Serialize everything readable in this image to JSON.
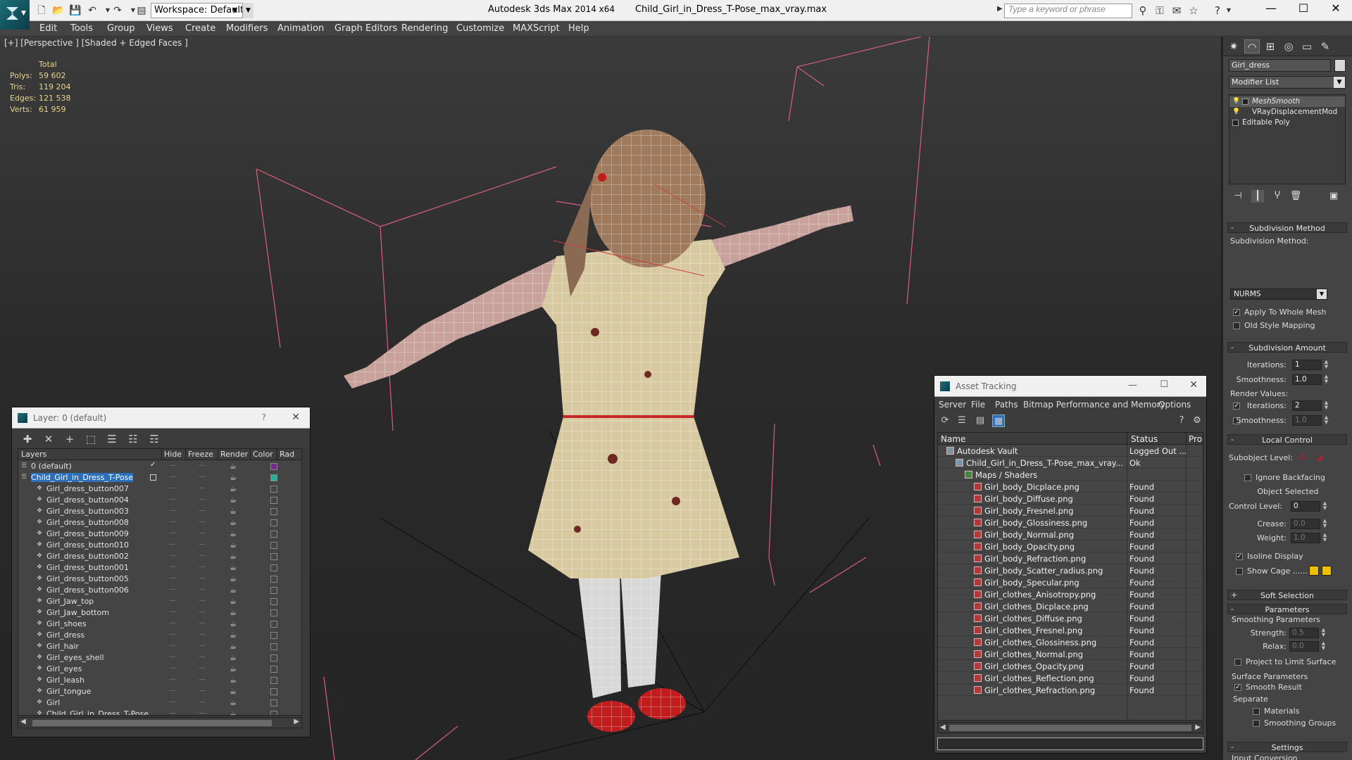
{
  "titlebar": {
    "workspace": "Workspace: Default",
    "app_name": "Autodesk 3ds Max",
    "app_version": "2014 x64",
    "file_name": "Child_Girl_in_Dress_T-Pose_max_vray.max",
    "search_placeholder": "Type a keyword or phrase"
  },
  "menu": [
    "Edit",
    "Tools",
    "Group",
    "Views",
    "Create",
    "Modifiers",
    "Animation",
    "Graph Editors",
    "Rendering",
    "Customize",
    "MAXScript",
    "Help"
  ],
  "viewport": {
    "label": "[+] [Perspective ] [Shaded + Edged Faces ]",
    "stats": {
      "header": "Total",
      "rows": [
        {
          "k": "Polys:",
          "v": "59 602"
        },
        {
          "k": "Tris:",
          "v": "119 204"
        },
        {
          "k": "Edges:",
          "v": "121 538"
        },
        {
          "k": "Verts:",
          "v": "61 959"
        }
      ]
    }
  },
  "layer_panel": {
    "title": "Layer: 0 (default)",
    "help": "?",
    "close": "✕",
    "headers": [
      "Layers",
      "Hide",
      "Freeze",
      "Render",
      "Color",
      "Rad"
    ],
    "rows": [
      {
        "name": "0 (default)",
        "level": 0,
        "swatch": "#7a2a8a",
        "check": true
      },
      {
        "name": "Child_Girl_in_Dress_T-Pose",
        "level": 0,
        "swatch": "#2ab09a",
        "selected": true
      },
      {
        "name": "Girl_dress_button007",
        "level": 1
      },
      {
        "name": "Girl_dress_button004",
        "level": 1
      },
      {
        "name": "Girl_dress_button003",
        "level": 1
      },
      {
        "name": "Girl_dress_button008",
        "level": 1
      },
      {
        "name": "Girl_dress_button009",
        "level": 1
      },
      {
        "name": "Girl_dress_button010",
        "level": 1
      },
      {
        "name": "Girl_dress_button002",
        "level": 1
      },
      {
        "name": "Girl_dress_button001",
        "level": 1
      },
      {
        "name": "Girl_dress_button005",
        "level": 1
      },
      {
        "name": "Girl_dress_button006",
        "level": 1
      },
      {
        "name": "Girl_Jaw_top",
        "level": 1
      },
      {
        "name": "Girl_Jaw_bottom",
        "level": 1
      },
      {
        "name": "Girl_shoes",
        "level": 1
      },
      {
        "name": "Girl_dress",
        "level": 1
      },
      {
        "name": "Girl_hair",
        "level": 1
      },
      {
        "name": "Girl_eyes_shell",
        "level": 1
      },
      {
        "name": "Girl_eyes",
        "level": 1
      },
      {
        "name": "Girl_leash",
        "level": 1
      },
      {
        "name": "Girl_tongue",
        "level": 1
      },
      {
        "name": "Girl",
        "level": 1
      },
      {
        "name": "Child_Girl_in_Dress_T-Pose",
        "level": 1
      }
    ]
  },
  "asset_panel": {
    "title": "Asset Tracking",
    "menu": [
      "Server",
      "File",
      "Paths",
      "Bitmap Performance and Memory",
      "Options"
    ],
    "headers": [
      "Name",
      "Status",
      "Pro"
    ],
    "rows": [
      {
        "name": "Autodesk Vault",
        "status": "Logged Out ...",
        "level": 0,
        "kind": "vault"
      },
      {
        "name": "Child_Girl_in_Dress_T-Pose_max_vray....",
        "status": "Ok",
        "level": 1,
        "kind": "file"
      },
      {
        "name": "Maps / Shaders",
        "status": "",
        "level": 2,
        "kind": "folder"
      },
      {
        "name": "Girl_body_Dicplace.png",
        "status": "Found",
        "level": 3,
        "kind": "png"
      },
      {
        "name": "Girl_body_Diffuse.png",
        "status": "Found",
        "level": 3,
        "kind": "png"
      },
      {
        "name": "Girl_body_Fresnel.png",
        "status": "Found",
        "level": 3,
        "kind": "png"
      },
      {
        "name": "Girl_body_Glossiness.png",
        "status": "Found",
        "level": 3,
        "kind": "png"
      },
      {
        "name": "Girl_body_Normal.png",
        "status": "Found",
        "level": 3,
        "kind": "png"
      },
      {
        "name": "Girl_body_Opacity.png",
        "status": "Found",
        "level": 3,
        "kind": "png"
      },
      {
        "name": "Girl_body_Refraction.png",
        "status": "Found",
        "level": 3,
        "kind": "png"
      },
      {
        "name": "Girl_body_Scatter_radius.png",
        "status": "Found",
        "level": 3,
        "kind": "png"
      },
      {
        "name": "Girl_body_Specular.png",
        "status": "Found",
        "level": 3,
        "kind": "png"
      },
      {
        "name": "Girl_clothes_Anisotropy.png",
        "status": "Found",
        "level": 3,
        "kind": "png"
      },
      {
        "name": "Girl_clothes_Dicplace.png",
        "status": "Found",
        "level": 3,
        "kind": "png"
      },
      {
        "name": "Girl_clothes_Diffuse.png",
        "status": "Found",
        "level": 3,
        "kind": "png"
      },
      {
        "name": "Girl_clothes_Fresnel.png",
        "status": "Found",
        "level": 3,
        "kind": "png"
      },
      {
        "name": "Girl_clothes_Glossiness.png",
        "status": "Found",
        "level": 3,
        "kind": "png"
      },
      {
        "name": "Girl_clothes_Normal.png",
        "status": "Found",
        "level": 3,
        "kind": "png"
      },
      {
        "name": "Girl_clothes_Opacity.png",
        "status": "Found",
        "level": 3,
        "kind": "png"
      },
      {
        "name": "Girl_clothes_Reflection.png",
        "status": "Found",
        "level": 3,
        "kind": "png"
      },
      {
        "name": "Girl_clothes_Refraction.png",
        "status": "Found",
        "level": 3,
        "kind": "png"
      }
    ]
  },
  "command_panel": {
    "object_name": "Girl_dress",
    "modifier_list": "Modifier List",
    "stack": [
      {
        "name": "MeshSmooth",
        "selected": true
      },
      {
        "name": "VRayDisplacementMod",
        "selected": false
      },
      {
        "name": "Editable Poly",
        "selected": false
      }
    ],
    "subdivision_method": {
      "title": "Subdivision Method",
      "label": "Subdivision Method:",
      "value": "NURMS",
      "apply_whole": "Apply To Whole Mesh",
      "apply_whole_checked": true,
      "old_style": "Old Style Mapping",
      "old_style_checked": false
    },
    "subdivision_amount": {
      "title": "Subdivision Amount",
      "iterations_label": "Iterations:",
      "iterations": "1",
      "smoothness_label": "Smoothness:",
      "smoothness": "1.0",
      "render_values": "Render Values:",
      "r_iterations_label": "Iterations:",
      "r_iterations": "2",
      "r_smoothness_label": "Smoothness:",
      "r_smoothness": "1.0"
    },
    "local_control": {
      "title": "Local Control",
      "subobject": "Subobject Level:",
      "ignore_backfacing": "Ignore Backfacing",
      "object_selected": "Object Selected",
      "control_level_label": "Control Level:",
      "control_level": "0",
      "crease_label": "Crease:",
      "crease": "0.0",
      "weight_label": "Weight:",
      "weight": "1.0",
      "isoline": "Isoline Display",
      "show_cage": "Show Cage ......",
      "cage_color1": "#f0c000",
      "cage_color2": "#f0c000"
    },
    "soft_selection": {
      "title": "Soft Selection"
    },
    "parameters": {
      "title": "Parameters",
      "smoothing": "Smoothing Parameters",
      "strength_label": "Strength:",
      "strength": "0.5",
      "relax_label": "Relax:",
      "relax": "0.0",
      "project": "Project to Limit Surface",
      "surface": "Surface Parameters",
      "smooth_result": "Smooth Result",
      "separate": "Separate",
      "materials": "Materials",
      "smoothing_groups": "Smoothing Groups"
    },
    "settings": {
      "title": "Settings",
      "input_conversion": "Input Conversion"
    }
  },
  "colors": {
    "accent_selection": "#2d6fb8",
    "stats_text": "#e7d38a",
    "png_icon": "#b03a3a"
  }
}
